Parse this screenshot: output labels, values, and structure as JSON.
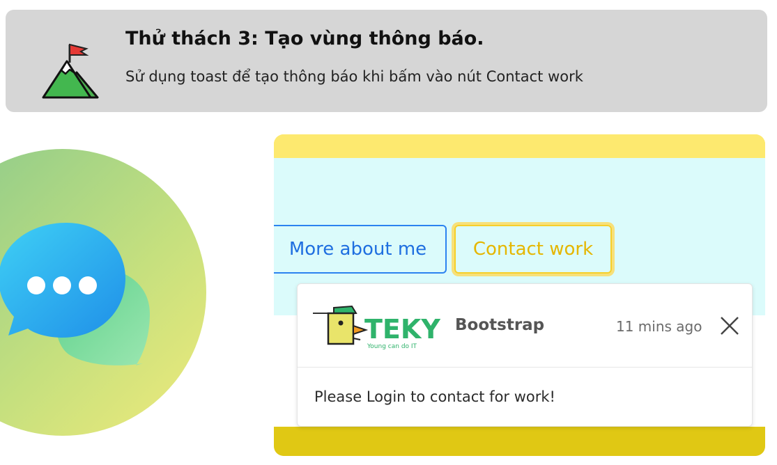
{
  "challenge": {
    "title": "Thử thách 3: Tạo vùng thông báo.",
    "description": "Sử dụng toast để tạo thông báo khi bấm vào nút Contact work",
    "icon": "mountain-flag-icon"
  },
  "illustration": {
    "icon": "chat-bubble-icon"
  },
  "demo": {
    "buttons": {
      "more_label": "More about me",
      "contact_label": "Contact work"
    },
    "toast": {
      "logo_text": "TEKY",
      "logo_tagline": "Young can do IT",
      "title": "Bootstrap",
      "time": "11 mins ago",
      "message": "Please Login to contact for work!",
      "close_icon": "close-icon"
    },
    "colors": {
      "primary": "#1f6fe0",
      "warning": "#e5b600",
      "panel_yellow": "#fde96f",
      "panel_bottom": "#e0c814",
      "content_bg": "#dbfbfb",
      "teky_green": "#2fb36b"
    }
  }
}
